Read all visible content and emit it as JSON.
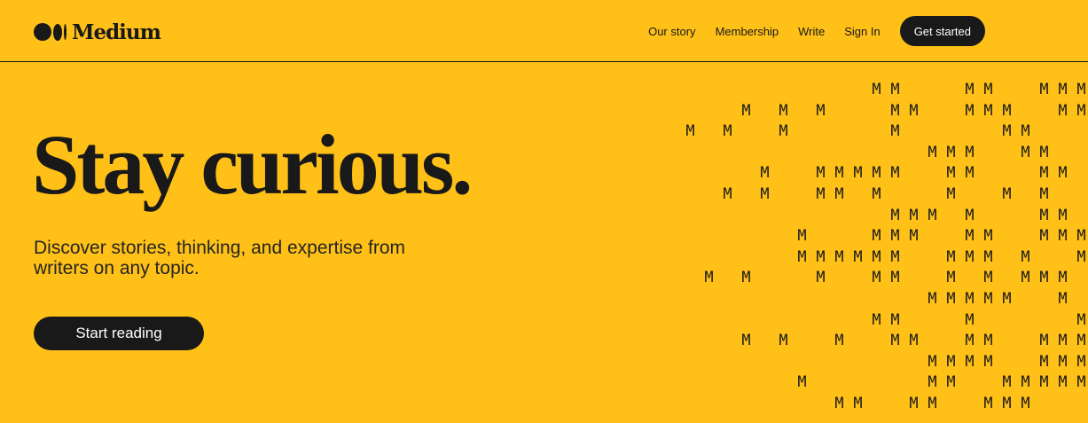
{
  "nav": {
    "brand": "Medium",
    "links": [
      "Our story",
      "Membership",
      "Write",
      "Sign In"
    ],
    "cta": "Get started"
  },
  "hero": {
    "title": "Stay curious.",
    "subtitle": "Discover stories, thinking, and expertise from writers on any topic.",
    "cta": "Start reading"
  },
  "art": {
    "glyph": "M",
    "rows": [
      "          MM   MM  MMMMM",
      "   M M M   MM  MMM  MM  ",
      "M M  M     M     MM   MM",
      "             MMM  MM  M ",
      "    M  MMMMM  MM   MM  M",
      "  M M  MM M   M  M M  M ",
      "           MMM M   MM  M",
      "      M   MMM  MM  MMMM ",
      "      MMMMMM  MMM M  MMM",
      " M M   M  MM  M M MMM   ",
      "             MMMMM  M MM",
      "          MM   M     MM ",
      "   M M  M  MM  MM  MMMM ",
      "             MMMM  MMM M",
      "      M      MM  MMMMMM ",
      "        MM  MM  MMM   MM"
    ]
  }
}
